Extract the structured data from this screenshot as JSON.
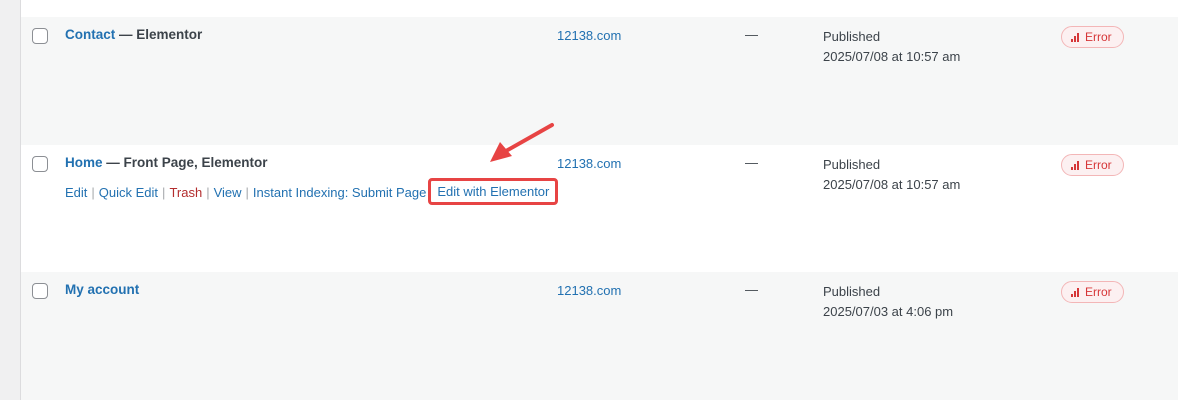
{
  "accent": "#2271b1",
  "annotation_color": "#e74444",
  "rows": [
    {
      "title_link": "Contact",
      "title_suffix": " — Elementor",
      "site": "12138.com",
      "dash": "—",
      "status": "Published",
      "date": "2025/07/08 at 10:57 am",
      "badge": "Error"
    },
    {
      "title_link": "Home",
      "title_suffix": " — Front Page, Elementor",
      "site": "12138.com",
      "dash": "—",
      "status": "Published",
      "date": "2025/07/08 at 10:57 am",
      "badge": "Error",
      "actions": {
        "edit": "Edit",
        "quick_edit": "Quick Edit",
        "trash": "Trash",
        "view": "View",
        "instant_indexing": "Instant Indexing: Submit Page",
        "edit_elementor": "Edit with Elementor",
        "separator": "|"
      }
    },
    {
      "title_link": "My account",
      "title_suffix": "",
      "site": "12138.com",
      "dash": "—",
      "status": "Published",
      "date": "2025/07/03 at 4:06 pm",
      "badge": "Error"
    }
  ]
}
